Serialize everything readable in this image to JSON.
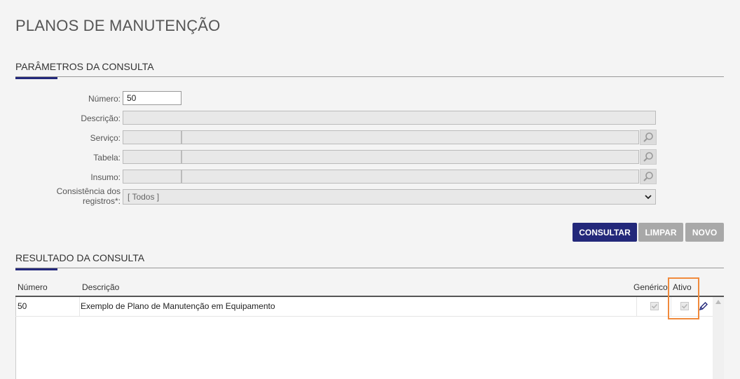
{
  "page": {
    "title": "PLANOS DE MANUTENÇÃO"
  },
  "params": {
    "title": "PARÂMETROS DA CONSULTA",
    "numero_label": "Número:",
    "numero_value": "50",
    "descricao_label": "Descrição:",
    "servico_label": "Serviço:",
    "tabela_label": "Tabela:",
    "insumo_label": "Insumo:",
    "consistencia_label_1": "Consistência dos",
    "consistencia_label_2": "registros*:",
    "consistencia_value": "[ Todos ]"
  },
  "actions": {
    "consultar": "CONSULTAR",
    "limpar": "LIMPAR",
    "novo": "NOVO"
  },
  "results": {
    "title": "RESULTADO DA CONSULTA",
    "columns": [
      "Número",
      "Descrição",
      "Genérico",
      "Ativo"
    ],
    "rows": [
      {
        "numero": "50",
        "descricao": "Exemplo de Plano de Manutenção em Equipamento",
        "generico": true,
        "ativo": true
      }
    ]
  },
  "colors": {
    "accent": "#23287a",
    "highlight": "#f08a3c",
    "disabled_button": "#a8a8a8"
  },
  "icons": [
    "search-icon",
    "chevron-down-icon",
    "edit-pencil-icon",
    "check-icon",
    "scroll-up-icon"
  ]
}
